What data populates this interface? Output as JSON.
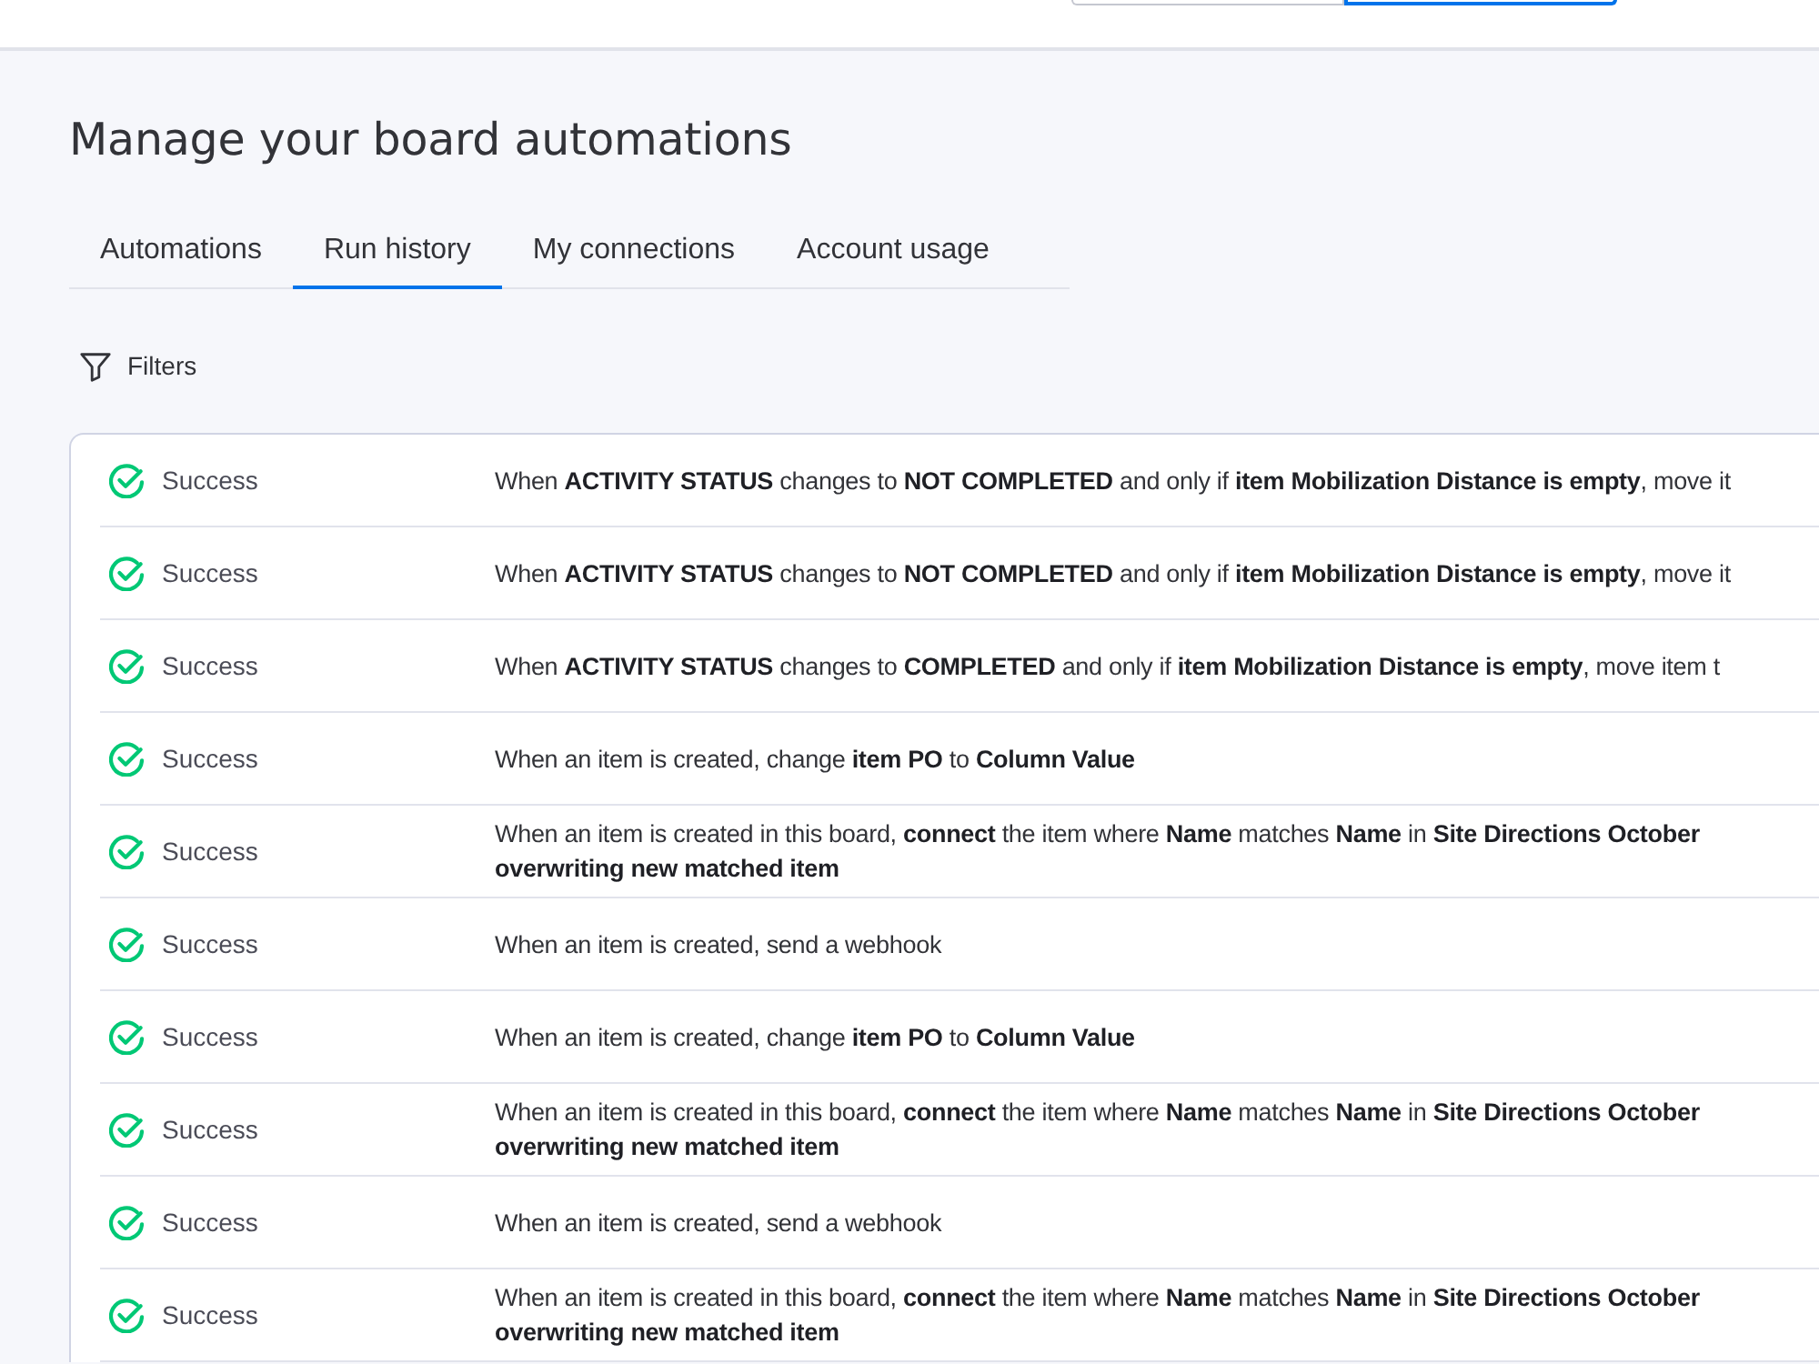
{
  "header": {
    "segments": [
      {
        "selected": false
      },
      {
        "selected": true
      }
    ]
  },
  "page": {
    "title": "Manage your board automations"
  },
  "tabs": [
    {
      "label": "Automations",
      "selected": false
    },
    {
      "label": "Run history",
      "selected": true
    },
    {
      "label": "My connections",
      "selected": false
    },
    {
      "label": "Account usage",
      "selected": false
    }
  ],
  "filters": {
    "label": "Filters"
  },
  "runs": [
    {
      "kind": "success",
      "status": "Success",
      "description": "When **ACTIVITY STATUS** changes to **NOT COMPLETED** and only if **item Mobilization Distance is empty**, move it"
    },
    {
      "kind": "success",
      "status": "Success",
      "description": "When **ACTIVITY STATUS** changes to **NOT COMPLETED** and only if **item Mobilization Distance is empty**, move it"
    },
    {
      "kind": "success",
      "status": "Success",
      "description": "When **ACTIVITY STATUS** changes to **COMPLETED** and only if **item Mobilization Distance is empty**, move item t"
    },
    {
      "kind": "success",
      "status": "Success",
      "description": "When an item is created, change **item PO** to **Column Value**"
    },
    {
      "kind": "success",
      "status": "Success",
      "description": "When an item is created in this board, **connect** the item where **Name** matches **Name** in **Site Directions October**\n**overwriting new matched item**"
    },
    {
      "kind": "success",
      "status": "Success",
      "description": "When an item is created, send a webhook"
    },
    {
      "kind": "success",
      "status": "Success",
      "description": "When an item is created, change **item PO** to **Column Value**"
    },
    {
      "kind": "success",
      "status": "Success",
      "description": "When an item is created in this board, **connect** the item where **Name** matches **Name** in **Site Directions October**\n**overwriting new matched item**"
    },
    {
      "kind": "success",
      "status": "Success",
      "description": "When an item is created, send a webhook"
    },
    {
      "kind": "success",
      "status": "Success",
      "description": "When an item is created in this board, **connect** the item where **Name** matches **Name** in **Site Directions October**\n**overwriting new matched item**"
    }
  ]
}
